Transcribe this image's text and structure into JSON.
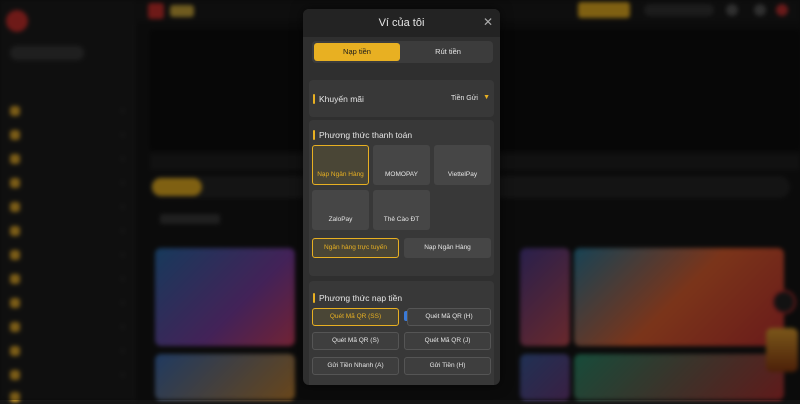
{
  "modal": {
    "title": "Ví của tôi",
    "close_icon": "close-icon",
    "tabs": [
      {
        "label": "Nạp tiền",
        "active": true
      },
      {
        "label": "Rút tiền",
        "active": false
      }
    ],
    "promotion": {
      "label": "Khuyến mãi",
      "value": "Tiền Gửi",
      "caret_icon": "caret-down-icon"
    },
    "payment": {
      "label": "Phương thức thanh toán",
      "options": [
        {
          "label": "Nạp Ngân Hàng",
          "selected": true
        },
        {
          "label": "MOMOPAY",
          "selected": false
        },
        {
          "label": "ViettelPay",
          "selected": false
        },
        {
          "label": "ZaloPay",
          "selected": false
        },
        {
          "label": "Thẻ Cào ĐT",
          "selected": false
        }
      ],
      "sub_options": [
        {
          "label": "Ngân hàng trực tuyến",
          "selected": true
        },
        {
          "label": "Nạp Ngân Hàng",
          "selected": false
        }
      ]
    },
    "deposit_method": {
      "label": "Phương thức nạp tiền",
      "options": [
        {
          "label": "Quét Mã QR (SS)",
          "selected": true,
          "badge_icon": "thumbs-up-icon"
        },
        {
          "label": "Quét Mã QR (H)",
          "selected": false
        },
        {
          "label": "Quét Mã QR (S)",
          "selected": false
        },
        {
          "label": "Quét Mã QR (J)",
          "selected": false
        },
        {
          "label": "Gửi Tiền Nhanh (A)",
          "selected": false
        },
        {
          "label": "Gửi Tiền (H)",
          "selected": false
        }
      ]
    }
  },
  "colors": {
    "accent": "#e8b022",
    "modal_bg": "#2f2f2f",
    "panel_bg": "#383838",
    "button_bg": "#464646"
  }
}
